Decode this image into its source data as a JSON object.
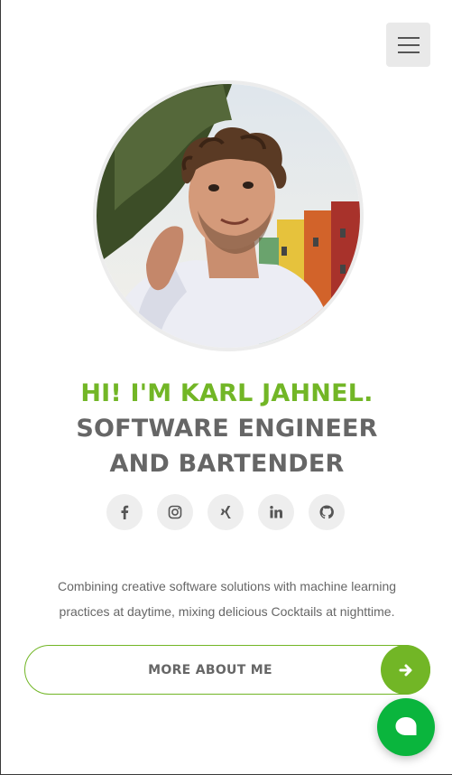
{
  "header": {
    "menu_icon": "hamburger-icon"
  },
  "hero": {
    "avatar_alt": "Profile photo of Karl Jahnel",
    "greeting": "HI! I'M KARL JAHNEL.",
    "role": "SOFTWARE ENGINEER AND BARTENDER",
    "accent_color": "#72b626",
    "heading_color": "#666666"
  },
  "socials": [
    {
      "icon": "facebook-icon"
    },
    {
      "icon": "instagram-icon"
    },
    {
      "icon": "xing-icon"
    },
    {
      "icon": "linkedin-icon"
    },
    {
      "icon": "github-icon"
    }
  ],
  "bio": {
    "text": "Combining creative software solutions with machine learning practices at daytime, mixing delicious Cocktails at nighttime."
  },
  "cta": {
    "label": "MORE ABOUT ME",
    "icon": "arrow-right-icon"
  },
  "chat": {
    "icon": "chat-bubble-icon",
    "color": "#0ab53d"
  }
}
